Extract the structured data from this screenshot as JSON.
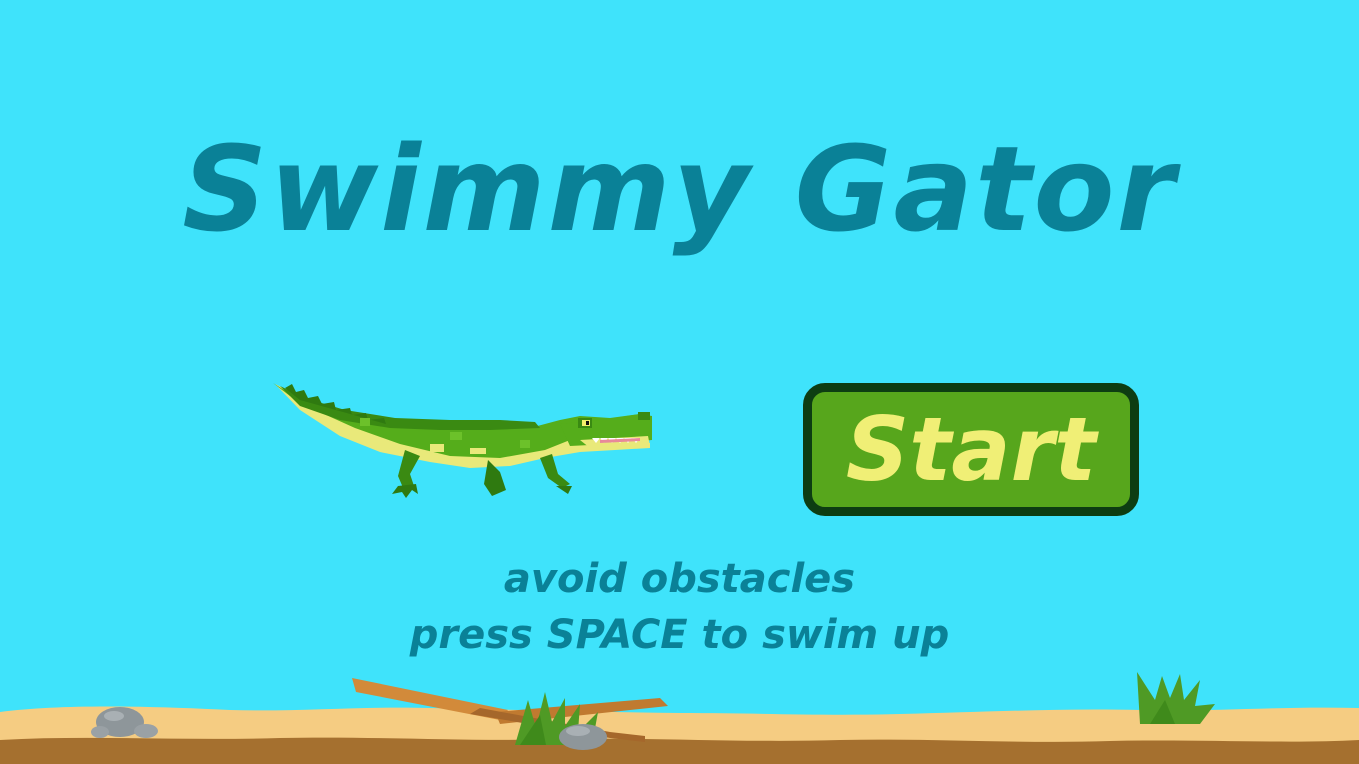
{
  "game": {
    "title": "Swimmy Gator",
    "start_label": "Start",
    "instructions": [
      "avoid obstacles",
      "press SPACE to swim up"
    ]
  },
  "colors": {
    "sky": "#3fe3fb",
    "title_text": "#0a8197",
    "button_fill": "#57a61c",
    "button_border": "#0d3d12",
    "button_text": "#f0ef76",
    "sand": "#f5cc82",
    "dirt": "#a5702f",
    "gator_body": "#55ad1b",
    "gator_belly": "#e9e97a"
  },
  "icons": [
    "gator-sprite",
    "rock-icon",
    "grass-tuft-icon",
    "driftwood-branch-icon"
  ]
}
